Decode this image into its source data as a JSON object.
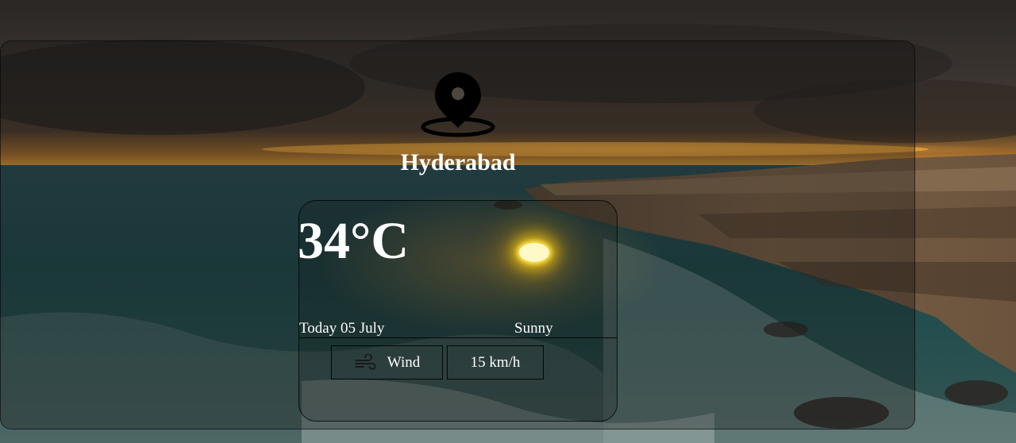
{
  "location": {
    "icon": "map-pin-icon",
    "city": "Hyderabad"
  },
  "weather": {
    "temperature": "34°C",
    "date": "Today 05 July",
    "condition": "Sunny",
    "condition_icon": "sun-icon",
    "wind_icon": "wind-icon",
    "wind_label": "Wind",
    "wind_speed": "15 km/h"
  },
  "colors": {
    "text": "#ffffff",
    "sun": "#ffe54a"
  }
}
